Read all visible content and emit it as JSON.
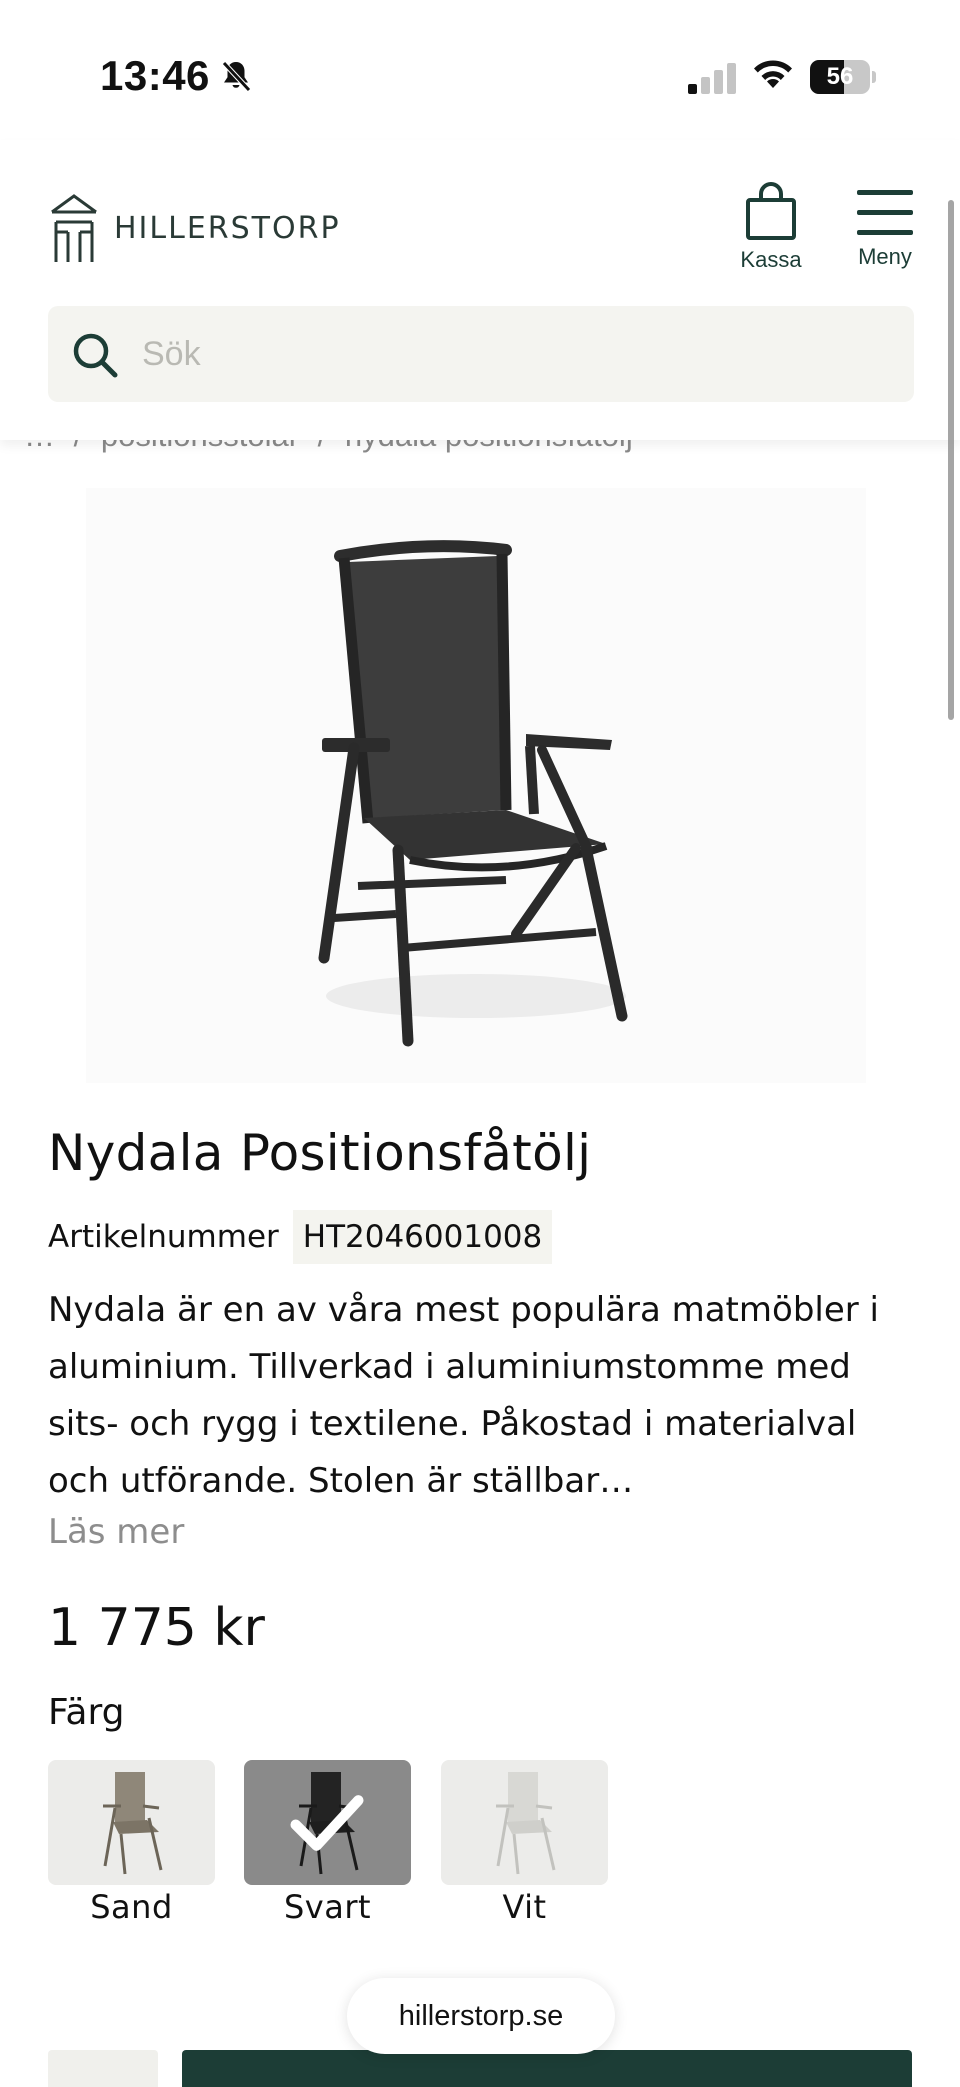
{
  "status_bar": {
    "time": "13:46",
    "battery": "56",
    "battery_level_percent": 56,
    "icons": [
      "bell-slash-icon",
      "cellular-signal-icon",
      "wifi-icon",
      "battery-icon"
    ]
  },
  "header": {
    "logo_text": "HILLERSTORP",
    "cart_label": "Kassa",
    "menu_label": "Meny",
    "search_placeholder": "Sök",
    "search_value": ""
  },
  "breadcrumb": {
    "ellipsis": "…",
    "separator": "/",
    "items": [
      "positionsstolar",
      "nydala positionsfåtölj"
    ]
  },
  "product": {
    "image_alt": "Nydala Positionsfåtölj",
    "title": "Nydala Positionsfåtölj",
    "sku_label": "Artikelnummer",
    "sku": "HT2046001008",
    "description": "Nydala är en av våra mest populära matmöbler i aluminium. Tillverkad i aluminiumstomme med sits- och rygg i textilene. Påkostad i materialval och utförande. Stolen är ställbar…",
    "read_more": "Läs mer",
    "price": "1 775 kr",
    "color_label": "Färg",
    "colors": [
      {
        "label": "Sand",
        "selected": false,
        "tone": "#a39a8c"
      },
      {
        "label": "Svart",
        "selected": true,
        "tone": "#2b2b2b"
      },
      {
        "label": "Vit",
        "selected": false,
        "tone": "#e6e6e2"
      }
    ]
  },
  "browser": {
    "url": "hillerstorp.se"
  },
  "colors": {
    "brand_green": "#1c3d36",
    "search_bg": "#f4f4f0",
    "muted_text": "#8d8d8d"
  }
}
